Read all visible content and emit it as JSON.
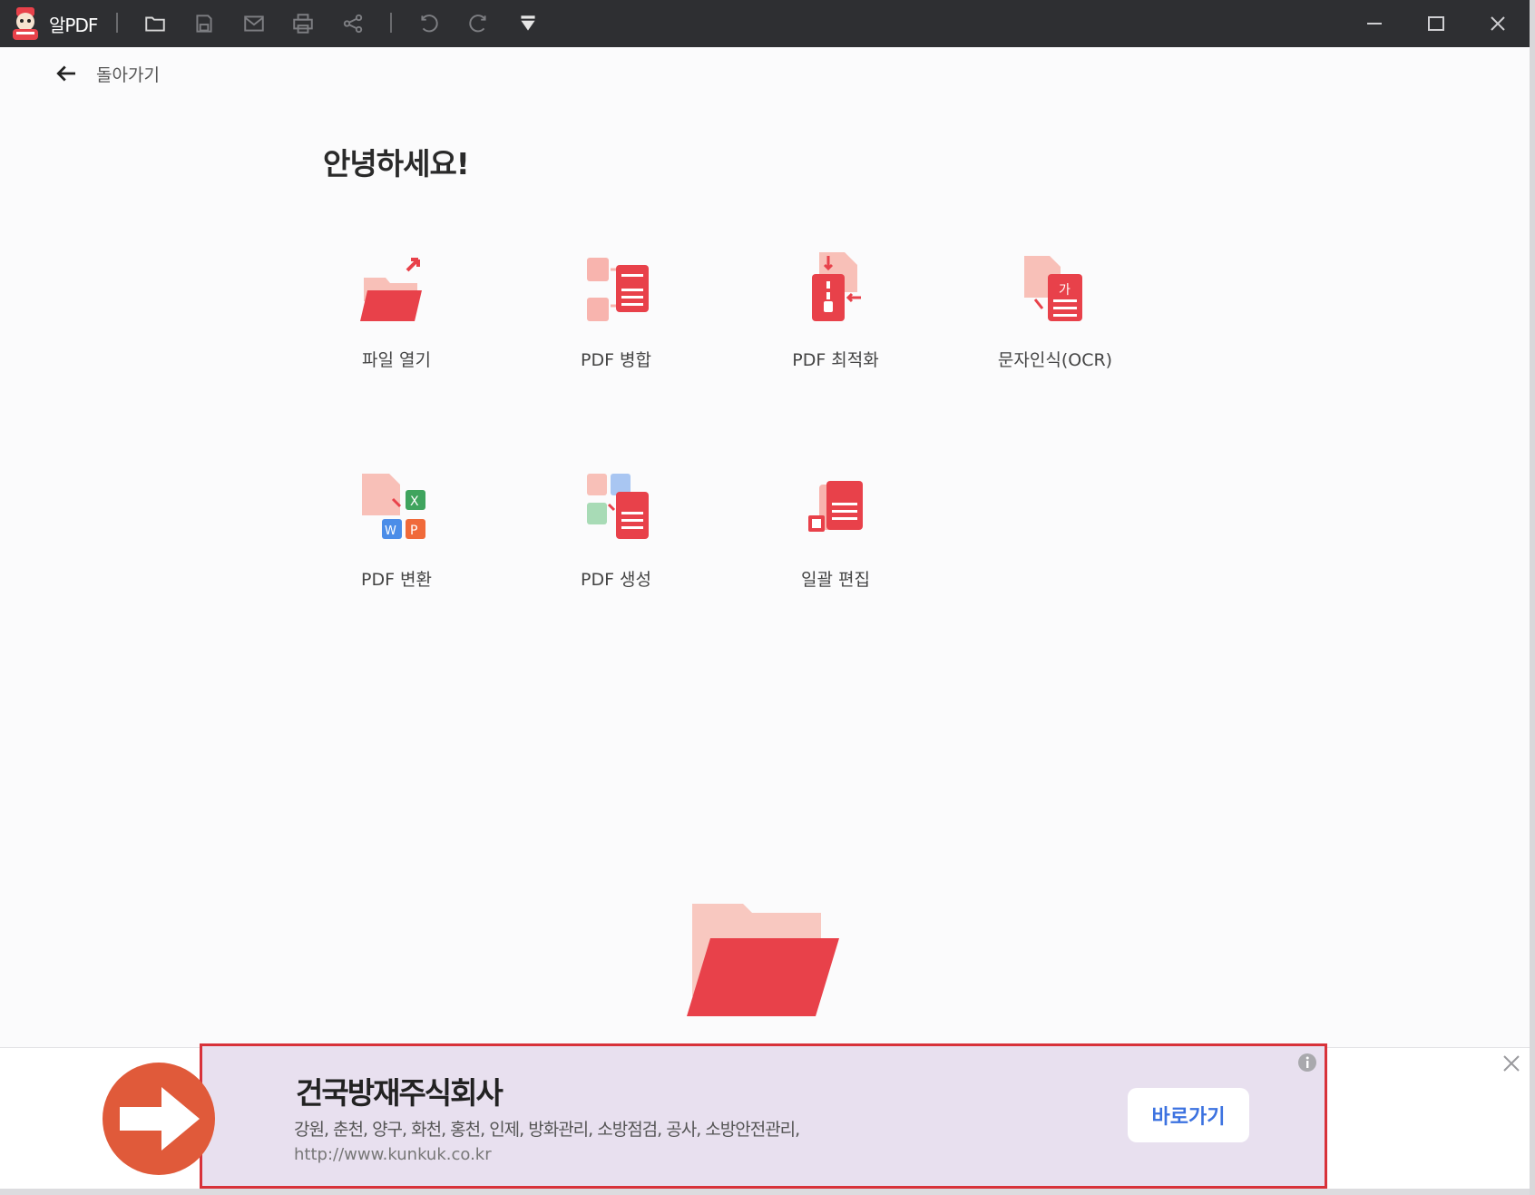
{
  "app": {
    "title": "알PDF"
  },
  "colors": {
    "brand": "#e8414a",
    "accent_light": "#f8b4ae",
    "titlebar": "#2e2f32",
    "ad_bg": "#e8e0ef",
    "ad_border": "#d8323a",
    "link": "#3c72e0",
    "orange": "#e05a3a"
  },
  "toolbar": {
    "icons": [
      "folder-icon",
      "save-icon",
      "mail-icon",
      "print-icon",
      "share-icon",
      "undo-icon",
      "redo-icon",
      "dropdown-icon"
    ]
  },
  "window": {
    "controls": [
      "minimize-icon",
      "maximize-icon",
      "close-icon"
    ]
  },
  "nav": {
    "back_label": "돌아가기"
  },
  "main": {
    "greeting": "안녕하세요!",
    "tools": [
      {
        "label": "파일 열기",
        "icon": "open-folder-icon"
      },
      {
        "label": "PDF 병합",
        "icon": "merge-pdf-icon"
      },
      {
        "label": "PDF 최적화",
        "icon": "compress-pdf-icon"
      },
      {
        "label": "문자인식(OCR)",
        "icon": "ocr-icon"
      },
      {
        "label": "PDF 변환",
        "icon": "convert-pdf-icon"
      },
      {
        "label": "PDF 생성",
        "icon": "create-pdf-icon"
      },
      {
        "label": "일괄 편집",
        "icon": "batch-edit-icon"
      }
    ]
  },
  "ad": {
    "title": "건국방재주식회사",
    "description": "강원, 춘천, 양구, 화천, 홍천, 인제, 방화관리, 소방점검, 공사, 소방안전관리,",
    "url": "http://www.kunkuk.co.kr",
    "button_label": "바로가기"
  }
}
